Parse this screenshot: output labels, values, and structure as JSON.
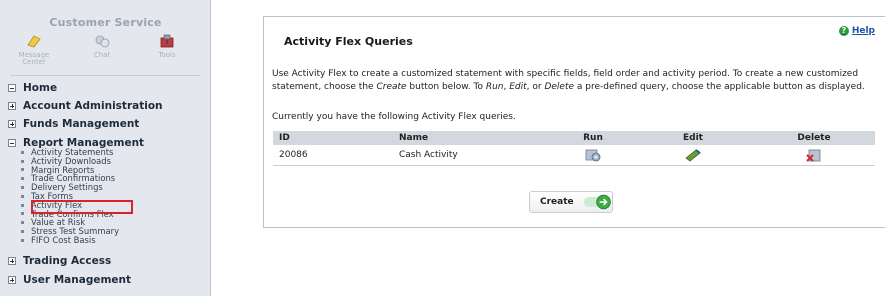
{
  "sidebar": {
    "customer_service_title": "Customer Service",
    "cs_icons": [
      {
        "label_line1": "Message",
        "label_line2": "Center",
        "icon": "message-center-icon"
      },
      {
        "label_line1": "Chat",
        "label_line2": "",
        "icon": "chat-icon"
      },
      {
        "label_line1": "Tools",
        "label_line2": "",
        "icon": "tools-icon"
      }
    ],
    "sections": {
      "home": "Home",
      "account_administration": "Account Administration",
      "funds_management": "Funds Management",
      "report_management": "Report Management",
      "trading_access": "Trading Access",
      "user_management": "User Management"
    },
    "report_items": [
      "Activity Statements",
      "Activity Downloads",
      "Margin Reports",
      "Trade Confirmations",
      "Delivery Settings",
      "Tax Forms",
      "Activity Flex",
      "Trade Confirms Flex",
      "Value at Risk",
      "Stress Test Summary",
      "FIFO Cost Basis"
    ]
  },
  "panel": {
    "title": "Activity Flex Queries",
    "help_label": "Help",
    "desc_part1": "Use Activity Flex to create a customized statement with specific fields, field order and activity period. To create a new customized statement, choose the ",
    "desc_create": "Create",
    "desc_part2": " button below. To ",
    "desc_run": "Run",
    "desc_comma1": ", ",
    "desc_edit": "Edit",
    "desc_or": ", or ",
    "desc_delete": "Delete",
    "desc_part3": " a pre-defined query, choose the applicable button as displayed.",
    "current_text": "Currently you have the following Activity Flex queries.",
    "table": {
      "headers": {
        "id": "ID",
        "name": "Name",
        "run": "Run",
        "edit": "Edit",
        "delete": "Delete"
      },
      "rows": [
        {
          "id": "20086",
          "name": "Cash Activity"
        }
      ]
    },
    "create_label": "Create"
  },
  "colors": {
    "highlight": "#d9222a",
    "help_link": "#1e56a6",
    "help_badge": "#2f9c3a",
    "table_header": "#d3d8de"
  }
}
